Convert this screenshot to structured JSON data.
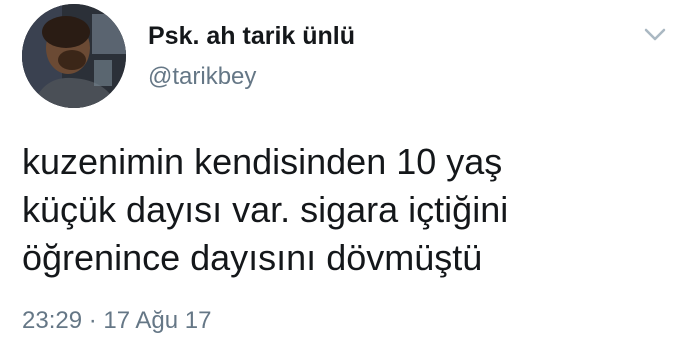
{
  "tweet": {
    "author": {
      "display_name": "Psk. ah tarik ünlü",
      "handle": "@tarikbey"
    },
    "text": "kuzenimin kendisinden 10 yaş\nküçük dayısı var. sigara içtiğini\nöğrenince dayısını dövmüştü",
    "timestamp": "23:29 · 17 Ağu 17",
    "menu_icon": "chevron-down-icon"
  },
  "colors": {
    "text_primary": "#14171a",
    "text_secondary": "#657786",
    "caret": "#aab8c2",
    "background": "#ffffff"
  }
}
